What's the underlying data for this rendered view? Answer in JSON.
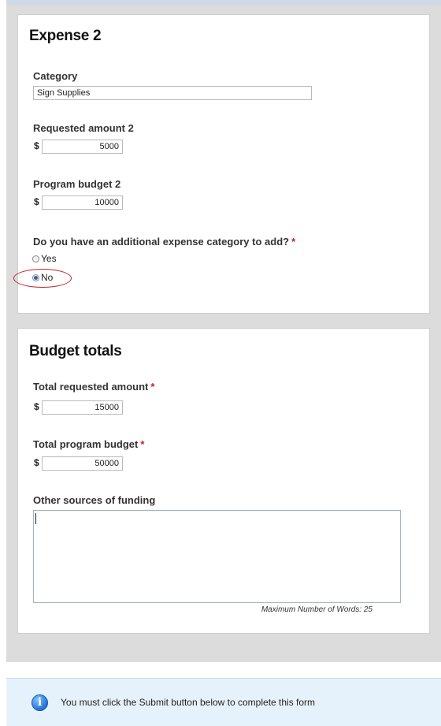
{
  "expense": {
    "title": "Expense 2",
    "category": {
      "label": "Category",
      "value": "Sign Supplies"
    },
    "requested_amount": {
      "label": "Requested amount 2",
      "currency": "$",
      "value": "5000"
    },
    "program_budget": {
      "label": "Program budget 2",
      "currency": "$",
      "value": "10000"
    },
    "additional": {
      "question": "Do you have an additional expense category to add?",
      "required_mark": "*",
      "options": [
        {
          "label": "Yes",
          "selected": false
        },
        {
          "label": "No",
          "selected": true
        }
      ]
    }
  },
  "budget": {
    "title": "Budget totals",
    "total_requested": {
      "label": "Total requested amount",
      "required_mark": "*",
      "currency": "$",
      "value": "15000"
    },
    "total_program": {
      "label": "Total program budget",
      "required_mark": "*",
      "currency": "$",
      "value": "50000"
    },
    "other_sources": {
      "label": "Other sources of funding",
      "value": "",
      "max_words_note": "Maximum Number of Words: 25"
    }
  },
  "notice": {
    "icon": "info-icon",
    "text": "You must click the Submit button below to complete this form"
  },
  "colors": {
    "required": "#d01c1c",
    "highlight": "#c0232e",
    "notice_bg": "#e6f2fb"
  }
}
